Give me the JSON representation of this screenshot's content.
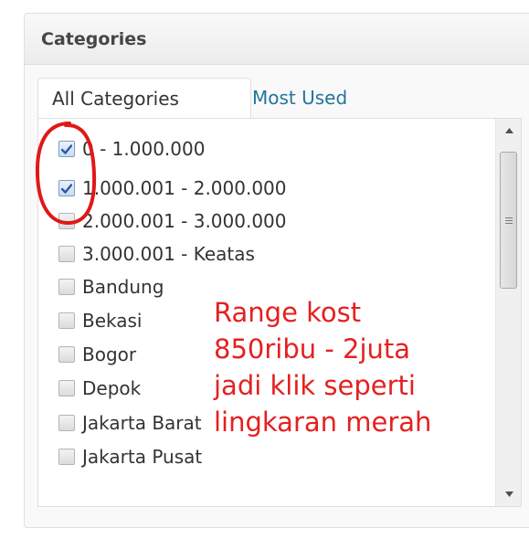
{
  "panel": {
    "title": "Categories"
  },
  "tabs": [
    {
      "label": "All Categories",
      "active": true
    },
    {
      "label": "Most Used",
      "active": false
    }
  ],
  "categories": [
    {
      "label": "0 - 1.000.000",
      "checked": true
    },
    {
      "label": "1.000.001 - 2.000.000",
      "checked": true
    },
    {
      "label": "2.000.001 - 3.000.000",
      "checked": false
    },
    {
      "label": "3.000.001 - Keatas",
      "checked": false
    },
    {
      "label": "Bandung",
      "checked": false
    },
    {
      "label": "Bekasi",
      "checked": false
    },
    {
      "label": "Bogor",
      "checked": false
    },
    {
      "label": "Depok",
      "checked": false
    },
    {
      "label": "Jakarta Barat",
      "checked": false
    },
    {
      "label": "Jakarta Pusat",
      "checked": false
    }
  ],
  "scroll": {
    "position_fraction": 0.0
  },
  "annotation": {
    "lines": [
      "Range kost",
      "850ribu - 2juta",
      "jadi klik seperti",
      "lingkaran merah"
    ],
    "color": "#e52020"
  },
  "colors": {
    "tab_link": "#21759b",
    "highlight_circle": "#e01818"
  },
  "icons": {
    "checkbox_checked": "check-icon",
    "scroll_up": "chevron-up-icon",
    "scroll_down": "chevron-down-icon"
  }
}
